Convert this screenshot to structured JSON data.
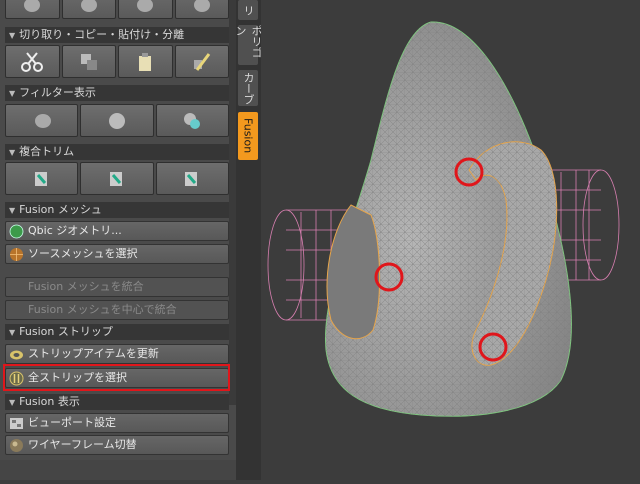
{
  "sections": {
    "cut_copy_paste": "切り取り・コピー・貼付け・分離",
    "filter_display": "フィルター表示",
    "compound_trim": "複合トリム",
    "fusion_mesh": "Fusion メッシュ",
    "fusion_strip": "Fusion ストリップ",
    "fusion_display": "Fusion 表示"
  },
  "buttons": {
    "qbic_geometry": "Qbic ジオメトリ...",
    "select_source_mesh": "ソースメッシュを選択",
    "merge_fusion_mesh": "Fusion メッシュを統合",
    "merge_fusion_mesh_center": "Fusion メッシュを中心で統合",
    "update_strip_items": "ストリップアイテムを更新",
    "select_all_strips": "全ストリップを選択",
    "viewport_settings": "ビューポート設定",
    "wireframe_toggle": "ワイヤーフレーム切替"
  },
  "tabs": {
    "tab_top": "リ",
    "polygon": "ポリゴン",
    "curve": "カーブ",
    "fusion": "Fusion"
  },
  "colors": {
    "accent": "#f3991e",
    "highlight": "#e0161b",
    "panel": "#4a4a4a",
    "mesh": "#9a9a9a",
    "wire_pink": "#d77fb0",
    "wire_green": "#7fc77f"
  }
}
